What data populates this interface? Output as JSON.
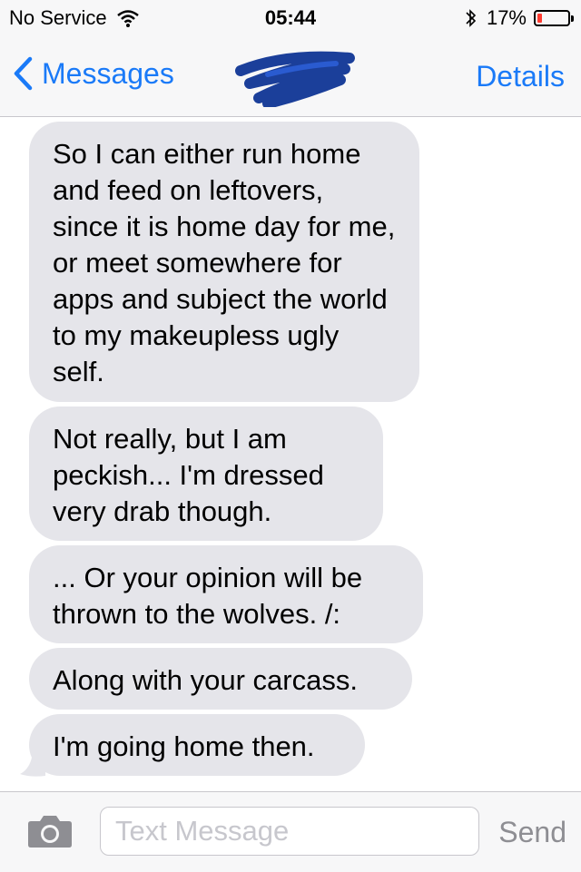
{
  "status_bar": {
    "carrier": "No Service",
    "time": "05:44",
    "battery_percent": "17%",
    "battery_level": 0.17,
    "battery_color": "#ff3b30",
    "icons": [
      "wifi-icon",
      "bluetooth-icon",
      "battery-icon"
    ]
  },
  "nav": {
    "back_label": "Messages",
    "details_label": "Details",
    "accent_color": "#1a7af8"
  },
  "messages": [
    {
      "text": "So I can either run home and feed on leftovers, since it is home day for me, or meet somewhere for apps and subject the world to my makeupless ugly self."
    },
    {
      "text": "Not really, but I am peckish... I'm dressed very drab though."
    },
    {
      "text": "... Or your opinion will be thrown to the wolves. /:"
    },
    {
      "text": "Along with your carcass."
    },
    {
      "text": "I'm going home then."
    }
  ],
  "input_bar": {
    "placeholder": "Text Message",
    "send_label": "Send",
    "camera_icon": "camera-icon"
  }
}
